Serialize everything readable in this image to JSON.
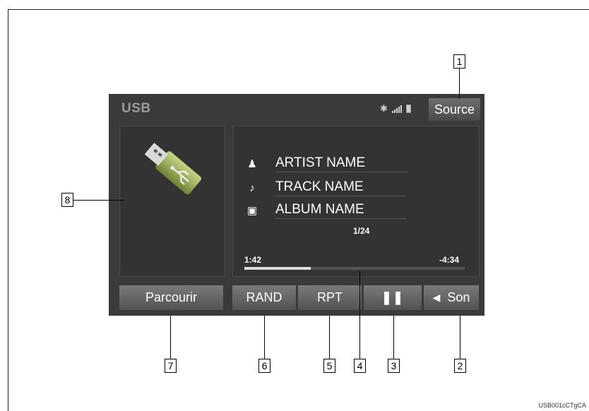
{
  "screen": {
    "title": "USB",
    "source_label": "Source",
    "status_icons": [
      "bluetooth-icon",
      "signal-icon",
      "battery-icon"
    ]
  },
  "now_playing": {
    "artist": "ARTIST NAME",
    "track": "TRACK NAME",
    "album": "ALBUM NAME",
    "track_count": "1/24",
    "elapsed": "1:42",
    "remaining": "-4:34",
    "progress_fraction": 0.3
  },
  "controls": {
    "parcourir": "Parcourir",
    "rand": "RAND",
    "rpt": "RPT",
    "pause_icon": "pause-icon",
    "son": "Son"
  },
  "callouts": [
    "1",
    "2",
    "3",
    "4",
    "5",
    "6",
    "7",
    "8"
  ],
  "footer": {
    "code": "USB001cCTgCA"
  },
  "colors": {
    "screen_bg": "#3a3a3a",
    "button": "#606060",
    "text": "#ffffff"
  }
}
